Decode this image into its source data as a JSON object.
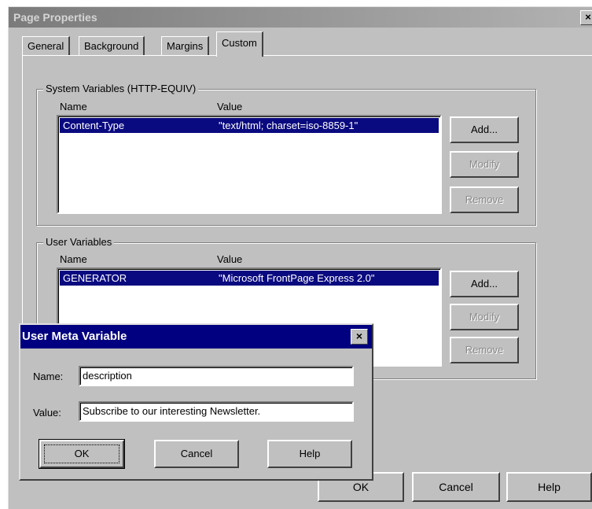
{
  "window": {
    "title": "Page Properties",
    "close_glyph": "×"
  },
  "tabs": [
    {
      "label": "General"
    },
    {
      "label": "Background"
    },
    {
      "label": "Margins"
    },
    {
      "label": "Custom"
    }
  ],
  "system_vars": {
    "legend": "System Variables (HTTP-EQUIV)",
    "col_name": "Name",
    "col_value": "Value",
    "rows": [
      {
        "name": "Content-Type",
        "value": "\"text/html; charset=iso-8859-1\""
      }
    ],
    "add": "Add...",
    "modify": "Modify",
    "remove": "Remove"
  },
  "user_vars": {
    "legend": "User Variables",
    "col_name": "Name",
    "col_value": "Value",
    "rows": [
      {
        "name": "GENERATOR",
        "value": "\"Microsoft FrontPage Express 2.0\""
      }
    ],
    "add": "Add...",
    "modify": "Modify",
    "remove": "Remove"
  },
  "footer": {
    "ok": "OK",
    "cancel": "Cancel",
    "help": "Help"
  },
  "modal": {
    "title": "User Meta Variable",
    "close_glyph": "×",
    "name_label": "Name:",
    "value_label": "Value:",
    "name_value": "description",
    "value_value": "Subscribe to our interesting Newsletter.",
    "ok": "OK",
    "cancel": "Cancel",
    "help": "Help"
  },
  "colors": {
    "title_active": "#000080",
    "selection": "#0a0a80",
    "face": "#c0c0c0"
  }
}
